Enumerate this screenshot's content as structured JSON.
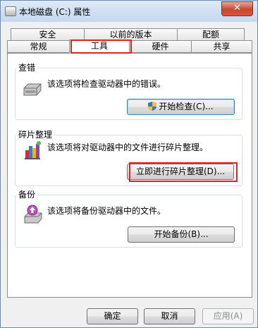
{
  "window": {
    "title": "本地磁盘 (C:) 属性",
    "close_label": "✕"
  },
  "tabs": {
    "row1": [
      "安全",
      "以前的版本",
      "配额"
    ],
    "row2": [
      "常规",
      "工具",
      "硬件",
      "共享"
    ],
    "active": "工具"
  },
  "groups": {
    "check": {
      "title": "查错",
      "desc": "该选项将检查驱动器中的错误。",
      "button": "开始检查(C)..."
    },
    "defrag": {
      "title": "碎片整理",
      "desc": "该选项将对驱动器中的文件进行碎片整理。",
      "button": "立即进行碎片整理(D)..."
    },
    "backup": {
      "title": "备份",
      "desc": "该选项将备份驱动器中的文件。",
      "button": "开始备份(B)..."
    }
  },
  "footer": {
    "ok": "确定",
    "cancel": "取消",
    "apply": "应用(A)"
  },
  "colors": {
    "highlight_red": "#e0241a",
    "focus_blue": "#3c7fb1"
  }
}
